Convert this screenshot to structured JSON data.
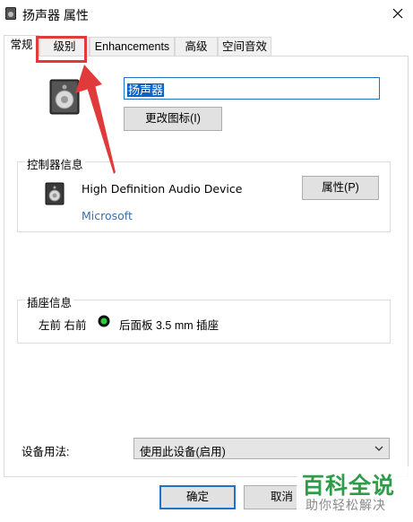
{
  "window": {
    "title": "扬声器 属性"
  },
  "tabs": [
    {
      "label": "常规",
      "active": true
    },
    {
      "label": "级别",
      "active": false
    },
    {
      "label": "Enhancements",
      "active": false
    },
    {
      "label": "高级",
      "active": false
    },
    {
      "label": "空间音效",
      "active": false
    }
  ],
  "general": {
    "device_name_value": "扬声器",
    "change_icon_label": "更改图标(I)"
  },
  "controller": {
    "group_label": "控制器信息",
    "device": "High Definition Audio Device",
    "vendor": "Microsoft",
    "properties_label": "属性(P)"
  },
  "jack": {
    "group_label": "插座信息",
    "position": "左前 右前",
    "description": "后面板 3.5 mm 插座",
    "status_color": "#2ecc40"
  },
  "usage": {
    "label": "设备用法:",
    "selected": "使用此设备(启用)"
  },
  "footer": {
    "ok_label": "确定",
    "cancel_label": "取消"
  },
  "annotation": {
    "highlight_color": "#e03a3a"
  },
  "watermark": {
    "main": "百科全说",
    "sub": "助你轻松解决"
  }
}
